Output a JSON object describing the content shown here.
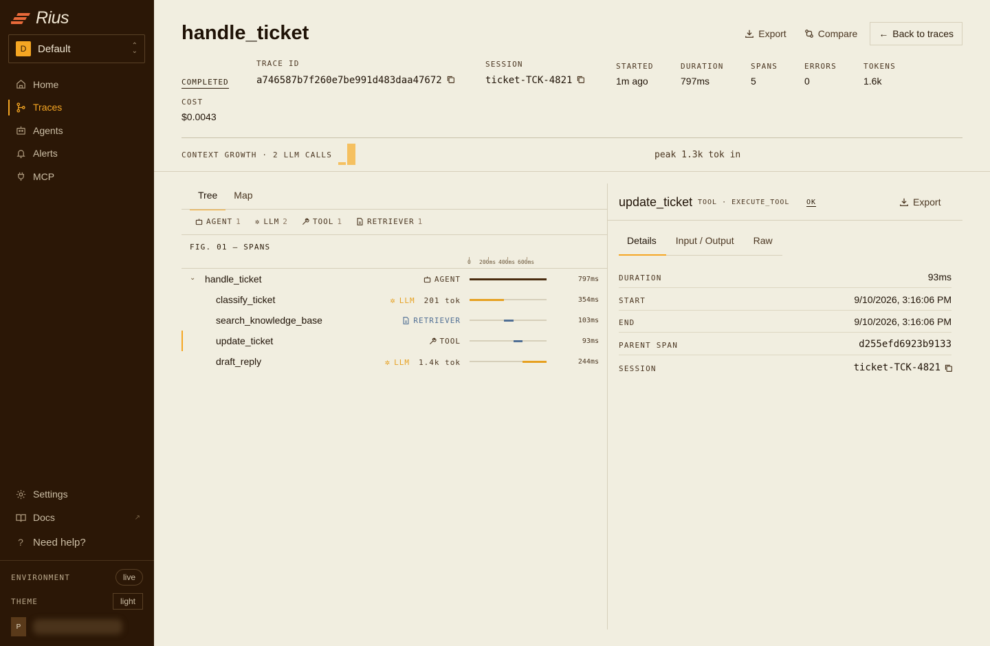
{
  "app": {
    "name": "Rius"
  },
  "workspace": {
    "badge": "D",
    "name": "Default"
  },
  "nav": {
    "items": [
      {
        "label": "Home",
        "icon": "home-icon"
      },
      {
        "label": "Traces",
        "icon": "traces-icon"
      },
      {
        "label": "Agents",
        "icon": "robot-icon"
      },
      {
        "label": "Alerts",
        "icon": "bell-icon"
      },
      {
        "label": "MCP",
        "icon": "plug-icon"
      }
    ],
    "active": "Traces",
    "bottom": [
      {
        "label": "Settings",
        "icon": "gear-icon"
      },
      {
        "label": "Docs",
        "icon": "book-icon"
      },
      {
        "label": "Need help?",
        "icon": "question-icon"
      }
    ]
  },
  "environment": {
    "label": "ENVIRONMENT",
    "value": "live"
  },
  "theme": {
    "label": "THEME",
    "value": "light"
  },
  "user": {
    "initial": "P"
  },
  "trace": {
    "title": "handle_ticket",
    "status": "COMPLETED",
    "trace_id_label": "TRACE ID",
    "trace_id": "a746587b7f260e7be991d483daa47672",
    "session_label": "SESSION",
    "session": "ticket-TCK-4821",
    "started_label": "STARTED",
    "started": "1m ago",
    "duration_label": "DURATION",
    "duration": "797ms",
    "spans_label": "SPANS",
    "spans": "5",
    "errors_label": "ERRORS",
    "errors": "0",
    "tokens_label": "TOKENS",
    "tokens": "1.6k",
    "cost_label": "COST",
    "cost": "$0.0043"
  },
  "actions": {
    "export": "Export",
    "compare": "Compare",
    "back": "Back to traces"
  },
  "context": {
    "label": "CONTEXT GROWTH · 2 LLM CALLS",
    "peak": "peak 1.3k tok in"
  },
  "tabs": {
    "tree": "Tree",
    "map": "Map"
  },
  "chips": [
    {
      "label": "AGENT",
      "count": "1",
      "icon": "robot-icon"
    },
    {
      "label": "LLM",
      "count": "2",
      "icon": "sparkle-icon"
    },
    {
      "label": "TOOL",
      "count": "1",
      "icon": "wrench-icon"
    },
    {
      "label": "RETRIEVER",
      "count": "1",
      "icon": "document-icon"
    }
  ],
  "figure": {
    "label": "FIG. 01 — SPANS",
    "ticks": [
      "0",
      "200ms",
      "400ms",
      "600ms"
    ]
  },
  "spans": [
    {
      "name": "handle_ticket",
      "kind": "AGENT",
      "tokens": "",
      "duration": "797ms",
      "start": 0,
      "end": 797,
      "color": "#4a2c10",
      "kindColor": "#4a3520",
      "icon": "robot-icon",
      "indent": 0,
      "expanded": true
    },
    {
      "name": "classify_ticket",
      "kind": "LLM",
      "tokens": "201 tok",
      "duration": "354ms",
      "start": 0,
      "end": 354,
      "color": "#e6a020",
      "kindColor": "#e6a020",
      "icon": "sparkle-icon",
      "indent": 1
    },
    {
      "name": "search_knowledge_base",
      "kind": "RETRIEVER",
      "tokens": "",
      "duration": "103ms",
      "start": 354,
      "end": 457,
      "color": "#4f6e94",
      "kindColor": "#4f6e94",
      "icon": "document-icon",
      "indent": 1
    },
    {
      "name": "update_ticket",
      "kind": "TOOL",
      "tokens": "",
      "duration": "93ms",
      "start": 457,
      "end": 550,
      "color": "#4f6e94",
      "kindColor": "#4a3520",
      "icon": "wrench-icon",
      "indent": 1,
      "selected": true
    },
    {
      "name": "draft_reply",
      "kind": "LLM",
      "tokens": "1.4k tok",
      "duration": "244ms",
      "start": 550,
      "end": 797,
      "color": "#e6a020",
      "kindColor": "#e6a020",
      "icon": "sparkle-icon",
      "indent": 1
    }
  ],
  "detail": {
    "title": "update_ticket",
    "kind": "TOOL · EXECUTE_TOOL",
    "status": "OK",
    "export": "Export",
    "tabs": [
      "Details",
      "Input / Output",
      "Raw"
    ],
    "rows": [
      {
        "key": "DURATION",
        "value": "93ms"
      },
      {
        "key": "START",
        "value": "9/10/2026, 3:16:06 PM"
      },
      {
        "key": "END",
        "value": "9/10/2026, 3:16:06 PM"
      },
      {
        "key": "PARENT SPAN",
        "value": "d255efd6923b9133"
      },
      {
        "key": "SESSION",
        "value": "ticket-TCK-4821"
      }
    ]
  }
}
